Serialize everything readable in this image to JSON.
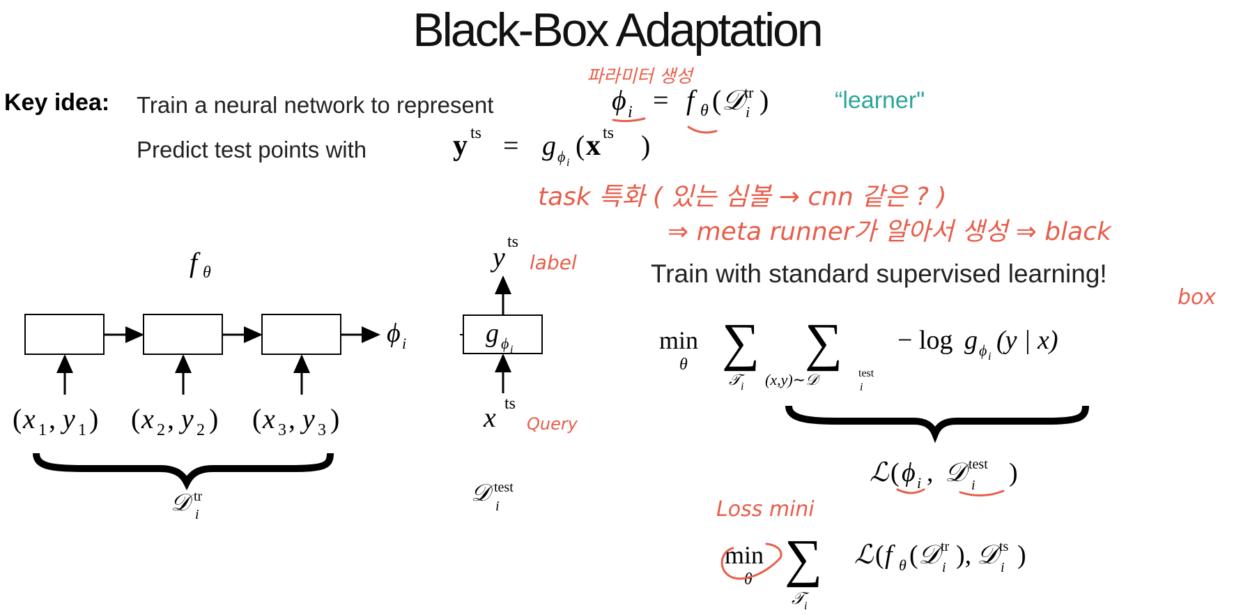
{
  "slide": {
    "title": "Black-Box Adaptation",
    "key_idea_label": "Key idea:",
    "key_idea_text": "Train a neural network to represent",
    "predict_text": "Predict test points with",
    "learner_label": "“learner\"",
    "train_text": "Train with standard supervised learning!"
  },
  "diagram": {
    "f_theta": "f",
    "f_sub": "θ",
    "phi_out": "ϕ",
    "phi_out_sub": "i",
    "inputs": [
      {
        "x": "x",
        "xs": "1",
        "y": "y",
        "ys": "1"
      },
      {
        "x": "x",
        "xs": "2",
        "y": "y",
        "ys": "2"
      },
      {
        "x": "x",
        "xs": "3",
        "y": "y",
        "ys": "3"
      }
    ],
    "d_tr": "𝒟",
    "d_tr_sup": "tr",
    "d_tr_sub": "i",
    "g_box": "g",
    "g_sub": "ϕ",
    "g_subsub": "i",
    "y_ts": "y",
    "ts": "ts",
    "x_ts": "x",
    "d_test": "𝒟",
    "d_test_sup": "test",
    "d_test_sub": "i"
  },
  "equations": {
    "phi": "ϕ",
    "i": "i",
    "eq": "=",
    "f": "f",
    "theta": "θ",
    "D": "𝒟",
    "tr": "tr",
    "ts": "ts",
    "test": "test",
    "y_bold": "y",
    "x_bold": "x",
    "g": "g",
    "min": "min",
    "sum": "∑",
    "T": "𝒯",
    "sum_sub2": "(x,y)∼𝒟",
    "neglog": "− log",
    "cond": "(y | x)",
    "L": "ℒ"
  },
  "annotations": {
    "param_gen": "파라미터 생성",
    "task_specific": "task 특화 ( 있는 심볼 → cnn 같은 ? )",
    "meta_learner": "⇒ meta runner가 알아서 생성 ⇒ black",
    "box": "box",
    "label": "label",
    "query": "Query",
    "loss_mini": "Loss mini"
  },
  "colors": {
    "ink": "#e85d4a",
    "learner": "#2aa59b"
  }
}
